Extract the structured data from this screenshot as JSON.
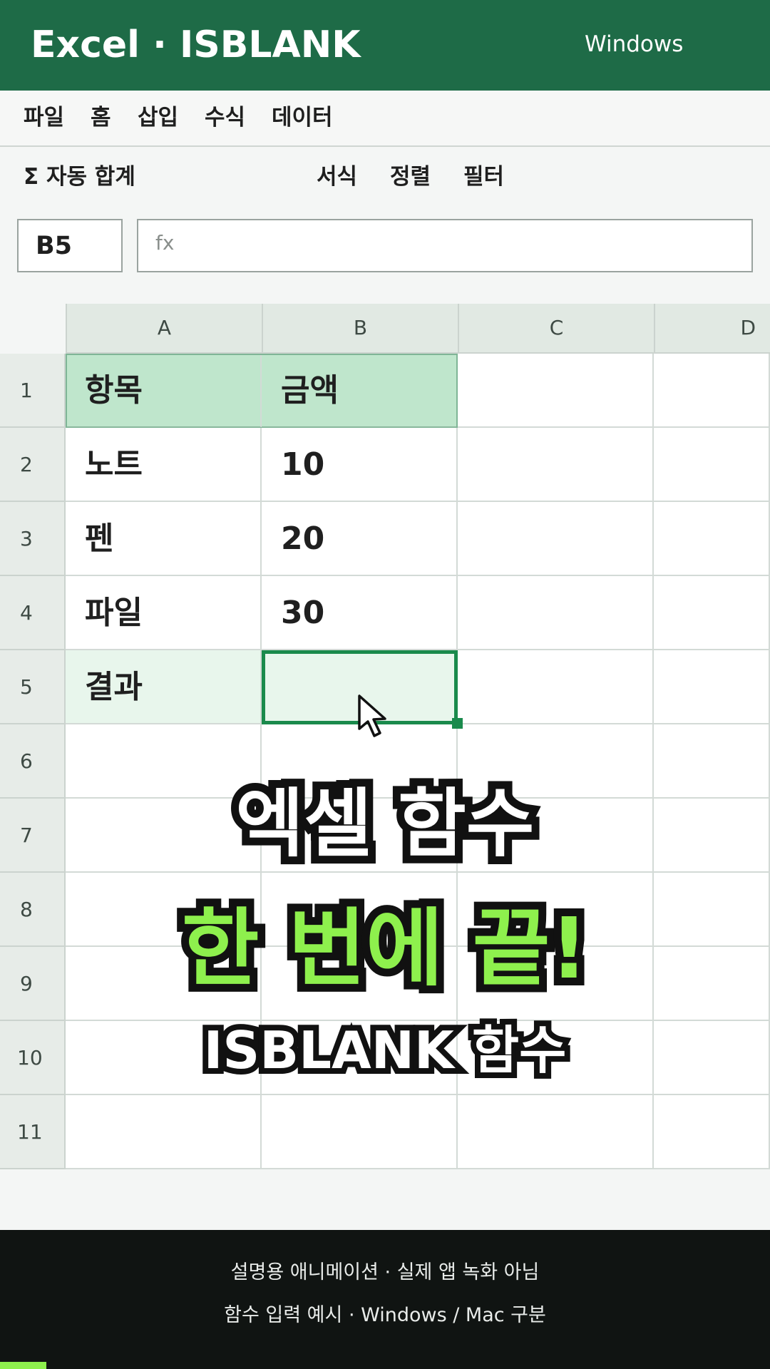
{
  "app": {
    "title": "Excel · ISBLANK",
    "os_label": "Windows"
  },
  "menu": [
    "파일",
    "홈",
    "삽입",
    "수식",
    "데이터"
  ],
  "toolbar": {
    "autosum": "Σ 자동 합계",
    "format": "서식",
    "sort": "정렬",
    "filter": "필터"
  },
  "formula": {
    "name_box": "B5",
    "fx_label": "fx",
    "value": ""
  },
  "sheet": {
    "columns": [
      "A",
      "B",
      "C",
      "D"
    ],
    "rows": [
      {
        "num": "1",
        "a": "항목",
        "b": "금액"
      },
      {
        "num": "2",
        "a": "노트",
        "b": "10"
      },
      {
        "num": "3",
        "a": "펜",
        "b": "20"
      },
      {
        "num": "4",
        "a": "파일",
        "b": "30"
      },
      {
        "num": "5",
        "a": "결과",
        "b": ""
      },
      {
        "num": "6",
        "a": "",
        "b": ""
      },
      {
        "num": "7",
        "a": "",
        "b": ""
      },
      {
        "num": "8",
        "a": "",
        "b": ""
      },
      {
        "num": "9",
        "a": "",
        "b": ""
      },
      {
        "num": "10",
        "a": "",
        "b": ""
      },
      {
        "num": "11",
        "a": "",
        "b": ""
      }
    ],
    "active_cell": "B5"
  },
  "overlay": {
    "line1": "엑셀 함수",
    "line2": "한 번에 끝!",
    "line3": "ISBLANK 함수"
  },
  "footer": {
    "line1": "설명용 애니메이션 · 실제 앱 녹화 아님",
    "line2": "함수 입력 예시 · Windows / Mac 구분",
    "progress": 0.06
  },
  "colors": {
    "brand": "#1e6b47",
    "accent": "#8ef04d",
    "selection": "#1a8a4c",
    "header_fill": "#bfe6cc"
  },
  "icons": {
    "cursor": "mouse-pointer-icon"
  }
}
